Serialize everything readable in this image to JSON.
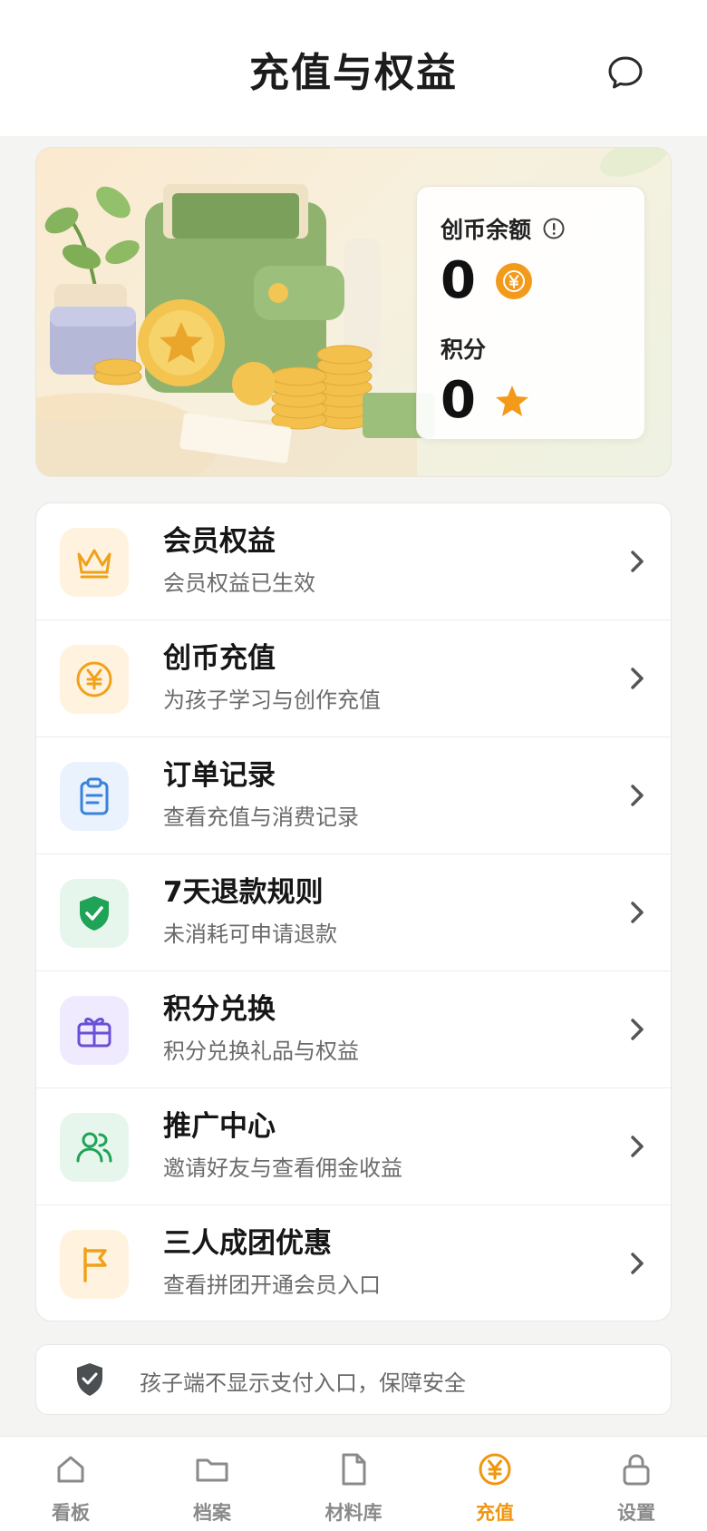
{
  "header": {
    "title": "充值与权益"
  },
  "balance": {
    "coin_label": "创币余额",
    "coin_value": "0",
    "points_label": "积分",
    "points_value": "0"
  },
  "menu": [
    {
      "title": "会员权益",
      "subtitle": "会员权益已生效",
      "icon": "crown-icon",
      "color": "#f0a11a",
      "bg": "#fff3df"
    },
    {
      "title": "创币充值",
      "subtitle": "为孩子学习与创作充值",
      "icon": "yuan-coin-icon",
      "color": "#f0a11a",
      "bg": "#fff3df"
    },
    {
      "title": "订单记录",
      "subtitle": "查看充值与消费记录",
      "icon": "clipboard-icon",
      "color": "#3a82d9",
      "bg": "#eaf2fd"
    },
    {
      "title": "7天退款规则",
      "subtitle": "未消耗可申请退款",
      "icon": "shield-check-icon",
      "color": "#1fa356",
      "bg": "#e7f6ec"
    },
    {
      "title": "积分兑换",
      "subtitle": "积分兑换礼品与权益",
      "icon": "gift-icon",
      "color": "#6b4fd6",
      "bg": "#efeafd"
    },
    {
      "title": "推广中心",
      "subtitle": "邀请好友与查看佣金收益",
      "icon": "users-icon",
      "color": "#1fa356",
      "bg": "#e7f6ec"
    },
    {
      "title": "三人成团优惠",
      "subtitle": "查看拼团开通会员入口",
      "icon": "flag-icon",
      "color": "#f0a11a",
      "bg": "#fff3df"
    }
  ],
  "notice": {
    "text": "孩子端不显示支付入口，保障安全"
  },
  "tabs": [
    {
      "label": "看板",
      "icon": "home-icon",
      "active": false
    },
    {
      "label": "档案",
      "icon": "folder-icon",
      "active": false
    },
    {
      "label": "材料库",
      "icon": "file-icon",
      "active": false
    },
    {
      "label": "充值",
      "icon": "yuan-coin-icon",
      "active": true
    },
    {
      "label": "设置",
      "icon": "lock-icon",
      "active": false
    }
  ],
  "colors": {
    "accent": "#f0960e",
    "inactive": "#8a8a8a"
  }
}
